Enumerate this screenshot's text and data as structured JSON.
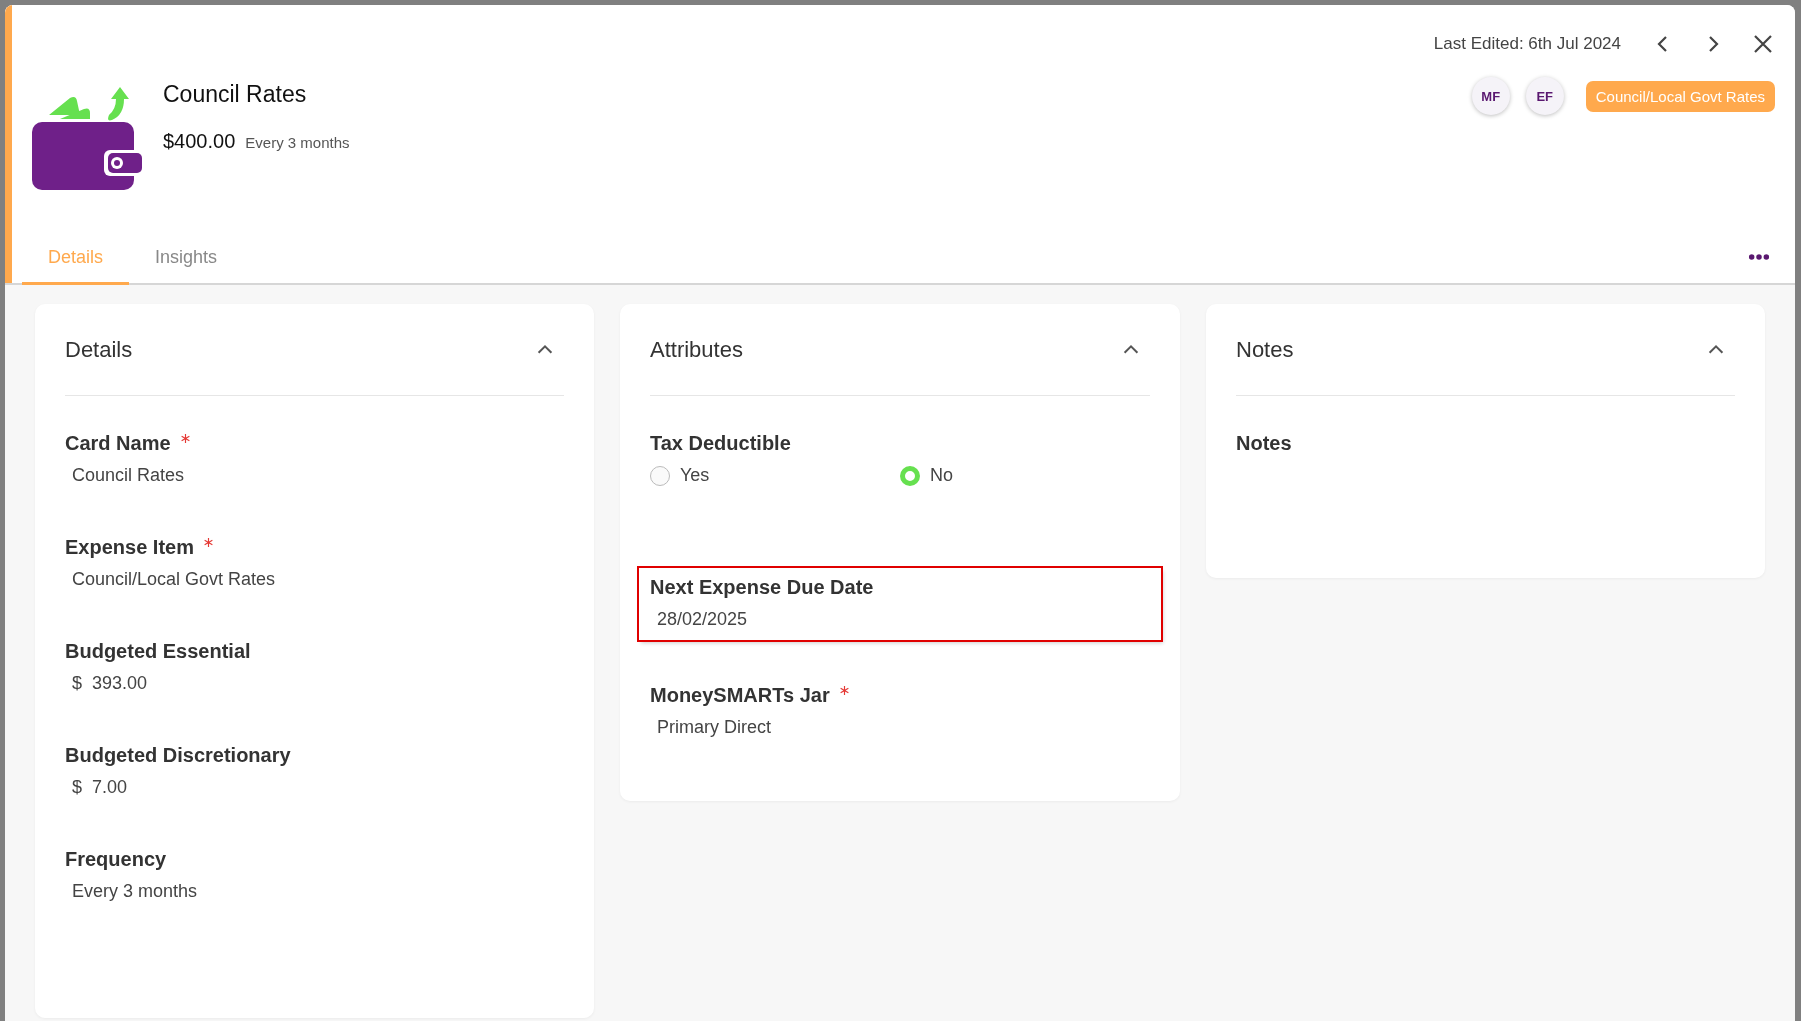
{
  "header": {
    "title": "Council Rates",
    "amount": "$400.00",
    "frequency": "Every 3 months",
    "last_edited": "Last Edited: 6th Jul 2024",
    "avatars": [
      "MF",
      "EF"
    ],
    "category": "Council/Local Govt Rates"
  },
  "tabs": [
    {
      "label": "Details",
      "selected": true
    },
    {
      "label": "Insights",
      "selected": false
    }
  ],
  "panels": [
    {
      "title": "Details",
      "expanded": true,
      "fields": [
        {
          "kind": "text",
          "label": "Card Name",
          "required": true,
          "value": "Council Rates",
          "highlighted": false
        },
        {
          "kind": "text",
          "label": "Expense Item",
          "required": true,
          "value": "Council/Local Govt Rates",
          "highlighted": false
        },
        {
          "kind": "text",
          "label": "Budgeted Essential",
          "required": false,
          "value": "$  393.00",
          "highlighted": false
        },
        {
          "kind": "text",
          "label": "Budgeted Discretionary",
          "required": false,
          "value": "$  7.00",
          "highlighted": false
        },
        {
          "kind": "text",
          "label": "Frequency",
          "required": false,
          "value": "Every 3 months",
          "highlighted": false
        }
      ]
    },
    {
      "title": "Attributes",
      "expanded": true,
      "fields": [
        {
          "kind": "radio",
          "label": "Tax Deductible",
          "required": false,
          "highlighted": false,
          "options": [
            {
              "label": "Yes",
              "selected": false
            },
            {
              "label": "No",
              "selected": true
            }
          ]
        },
        {
          "kind": "text",
          "label": "Next Expense Due Date",
          "required": false,
          "value": "28/02/2025",
          "highlighted": true
        },
        {
          "kind": "text",
          "label": "MoneySMARTs Jar",
          "required": true,
          "value": "Primary Direct",
          "highlighted": false
        }
      ]
    },
    {
      "title": "Notes",
      "expanded": true,
      "fields": [
        {
          "kind": "heading",
          "label": "Notes",
          "required": false,
          "highlighted": false
        }
      ]
    }
  ]
}
